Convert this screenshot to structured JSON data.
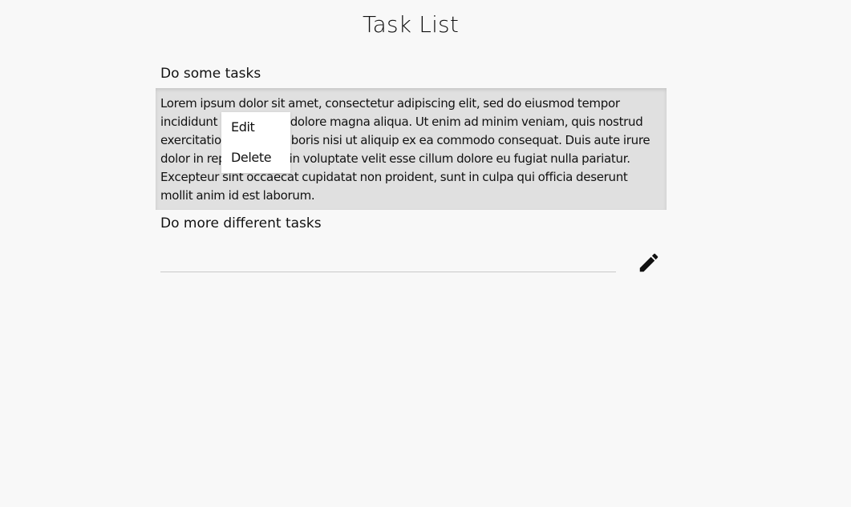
{
  "page": {
    "title": "Task List"
  },
  "tasks": [
    {
      "title": "Do some tasks",
      "body": "Lorem ipsum dolor sit amet, consectetur adipiscing elit, sed do eiusmod tempor incididunt ut labore et dolore magna aliqua. Ut enim ad minim veniam, quis nostrud exercitation ullamco laboris nisi ut aliquip ex ea commodo consequat. Duis aute irure dolor in reprehenderit in voluptate velit esse cillum dolore eu fugiat nulla pariatur. Excepteur sint occaecat cupidatat non proident, sunt in culpa qui officia deserunt mollit anim id est laborum."
    },
    {
      "title": "Do more different tasks",
      "input_value": "",
      "edit_icon": "pencil-icon"
    }
  ],
  "context_menu": {
    "items": [
      {
        "label": "Edit"
      },
      {
        "label": "Delete"
      }
    ]
  }
}
